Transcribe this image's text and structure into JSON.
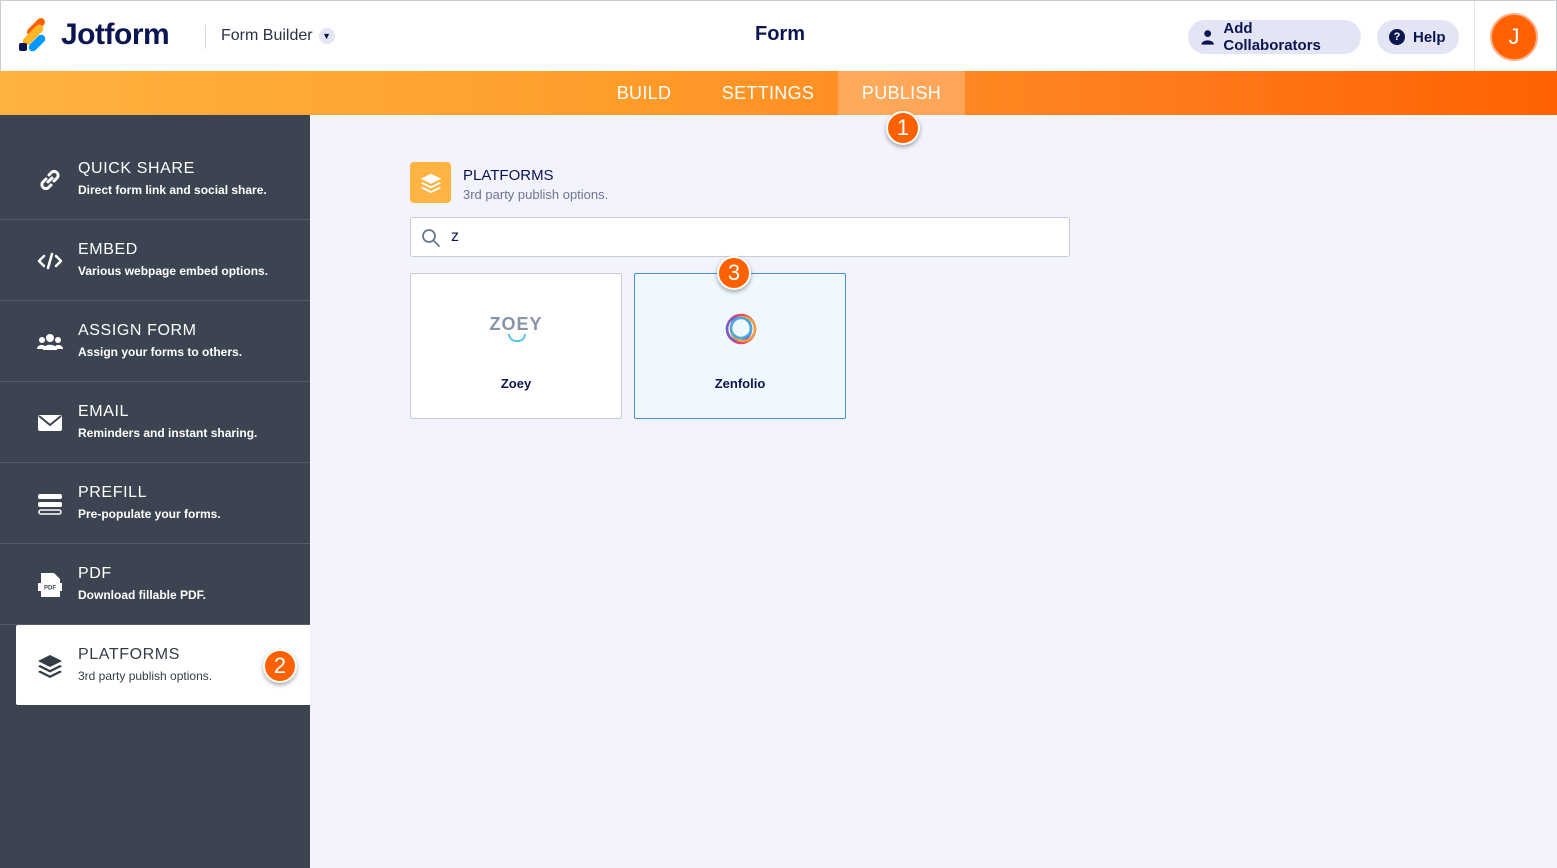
{
  "header": {
    "brand": "Jotform",
    "builder_label": "Form Builder",
    "form_title": "Form",
    "collab_label": "Add Collaborators",
    "help_label": "Help",
    "avatar_initial": "J"
  },
  "nav": {
    "tabs": [
      {
        "label": "BUILD"
      },
      {
        "label": "SETTINGS"
      },
      {
        "label": "PUBLISH"
      }
    ]
  },
  "steps": [
    "1",
    "2",
    "3"
  ],
  "sidebar": {
    "items": [
      {
        "title": "QUICK SHARE",
        "desc": "Direct form link and social share.",
        "icon": "link-icon"
      },
      {
        "title": "EMBED",
        "desc": "Various webpage embed options.",
        "icon": "code-icon"
      },
      {
        "title": "ASSIGN FORM",
        "desc": "Assign your forms to others.",
        "icon": "users-icon"
      },
      {
        "title": "EMAIL",
        "desc": "Reminders and instant sharing.",
        "icon": "envelope-icon"
      },
      {
        "title": "PREFILL",
        "desc": "Pre-populate your forms.",
        "icon": "prefill-icon"
      },
      {
        "title": "PDF",
        "desc": "Download fillable PDF.",
        "icon": "pdf-icon"
      },
      {
        "title": "PLATFORMS",
        "desc": "3rd party publish options.",
        "icon": "layers-icon"
      }
    ]
  },
  "main": {
    "section_title": "PLATFORMS",
    "section_sub": "3rd party publish options.",
    "search_value": "z",
    "cards": [
      {
        "name": "Zoey",
        "logo_text": "ZOEY"
      },
      {
        "name": "Zenfolio"
      }
    ]
  },
  "colors": {
    "accent": "#ff6100",
    "sidebar_bg": "#3d4451",
    "main_bg": "#f3f3fe",
    "navy": "#0a1551"
  }
}
